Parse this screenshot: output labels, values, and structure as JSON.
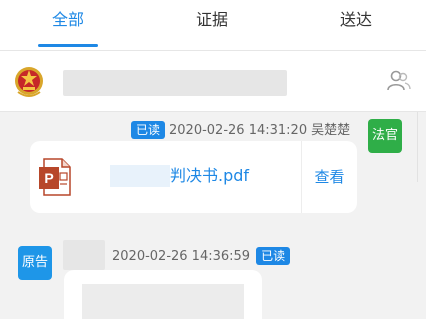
{
  "tabs": [
    {
      "label": "全部",
      "active": true
    },
    {
      "label": "证据",
      "active": false
    },
    {
      "label": "送达",
      "active": false
    }
  ],
  "colors": {
    "accent": "#1e88e5",
    "judge_avatar": "#2fae48",
    "plaintiff_avatar": "#1e96e8",
    "ppt_icon": "#b7472a"
  },
  "messages": [
    {
      "read_badge": "已读",
      "timestamp": "2020-02-26 14:31:20",
      "sender_name": "吴楚楚",
      "avatar_label": "法官",
      "file_name": "判决书.pdf",
      "view_label": "查看",
      "file_icon": "powerpoint-file-icon"
    },
    {
      "read_badge": "已读",
      "timestamp": "2020-02-26 14:36:59",
      "avatar_label": "原告"
    }
  ],
  "icons": {
    "emblem": "court-emblem-icon",
    "user": "users-icon"
  }
}
